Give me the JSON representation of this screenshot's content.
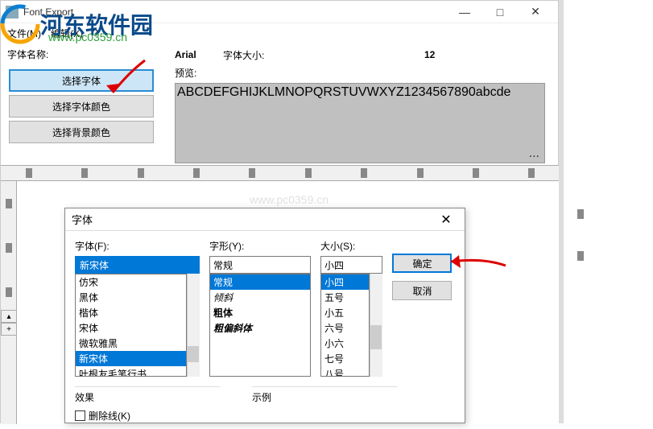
{
  "window": {
    "title": "Font Export",
    "minimize": "—",
    "maximize": "□",
    "close": "✕"
  },
  "menu": {
    "file": "文件(M)",
    "edit": "编辑(X)",
    "help": "?"
  },
  "watermark": {
    "name": "河东软件园",
    "url": "www.pc0359.cn"
  },
  "labels": {
    "font_name": "字体名称:",
    "font_size": "字体大小:",
    "preview": "预览:"
  },
  "font_info": {
    "name": "Arial",
    "size": "12"
  },
  "buttons": {
    "select_font": "选择字体",
    "select_font_color": "选择字体颜色",
    "select_bg_color": "选择背景颜色"
  },
  "preview_text": "ABCDEFGHIJKLMNOPQRSTUVWXYZ1234567890abcde",
  "preview_more": "...",
  "scroll": {
    "up": "▴",
    "down": "+"
  },
  "font_dialog": {
    "title": "字体",
    "close": "✕",
    "font_label": "字体(F):",
    "style_label": "字形(Y):",
    "size_label": "大小(S):",
    "font_input": "新宋体",
    "style_input": "常规",
    "size_input": "小四",
    "fonts": [
      "仿宋",
      "黑体",
      "楷体",
      "宋体",
      "微软雅黑",
      "新宋体",
      "叶根友毛笔行书"
    ],
    "styles": [
      {
        "text": "常规",
        "cls": "sel"
      },
      {
        "text": "倾斜",
        "cls": "italic"
      },
      {
        "text": "粗体",
        "cls": "bold"
      },
      {
        "text": "粗偏斜体",
        "cls": "bolditalic"
      }
    ],
    "sizes": [
      "小四",
      "五号",
      "小五",
      "六号",
      "小六",
      "七号",
      "八号"
    ],
    "ok": "确定",
    "cancel": "取消",
    "effects_label": "效果",
    "sample_label": "示例",
    "strikeout": "删除线(K)"
  }
}
